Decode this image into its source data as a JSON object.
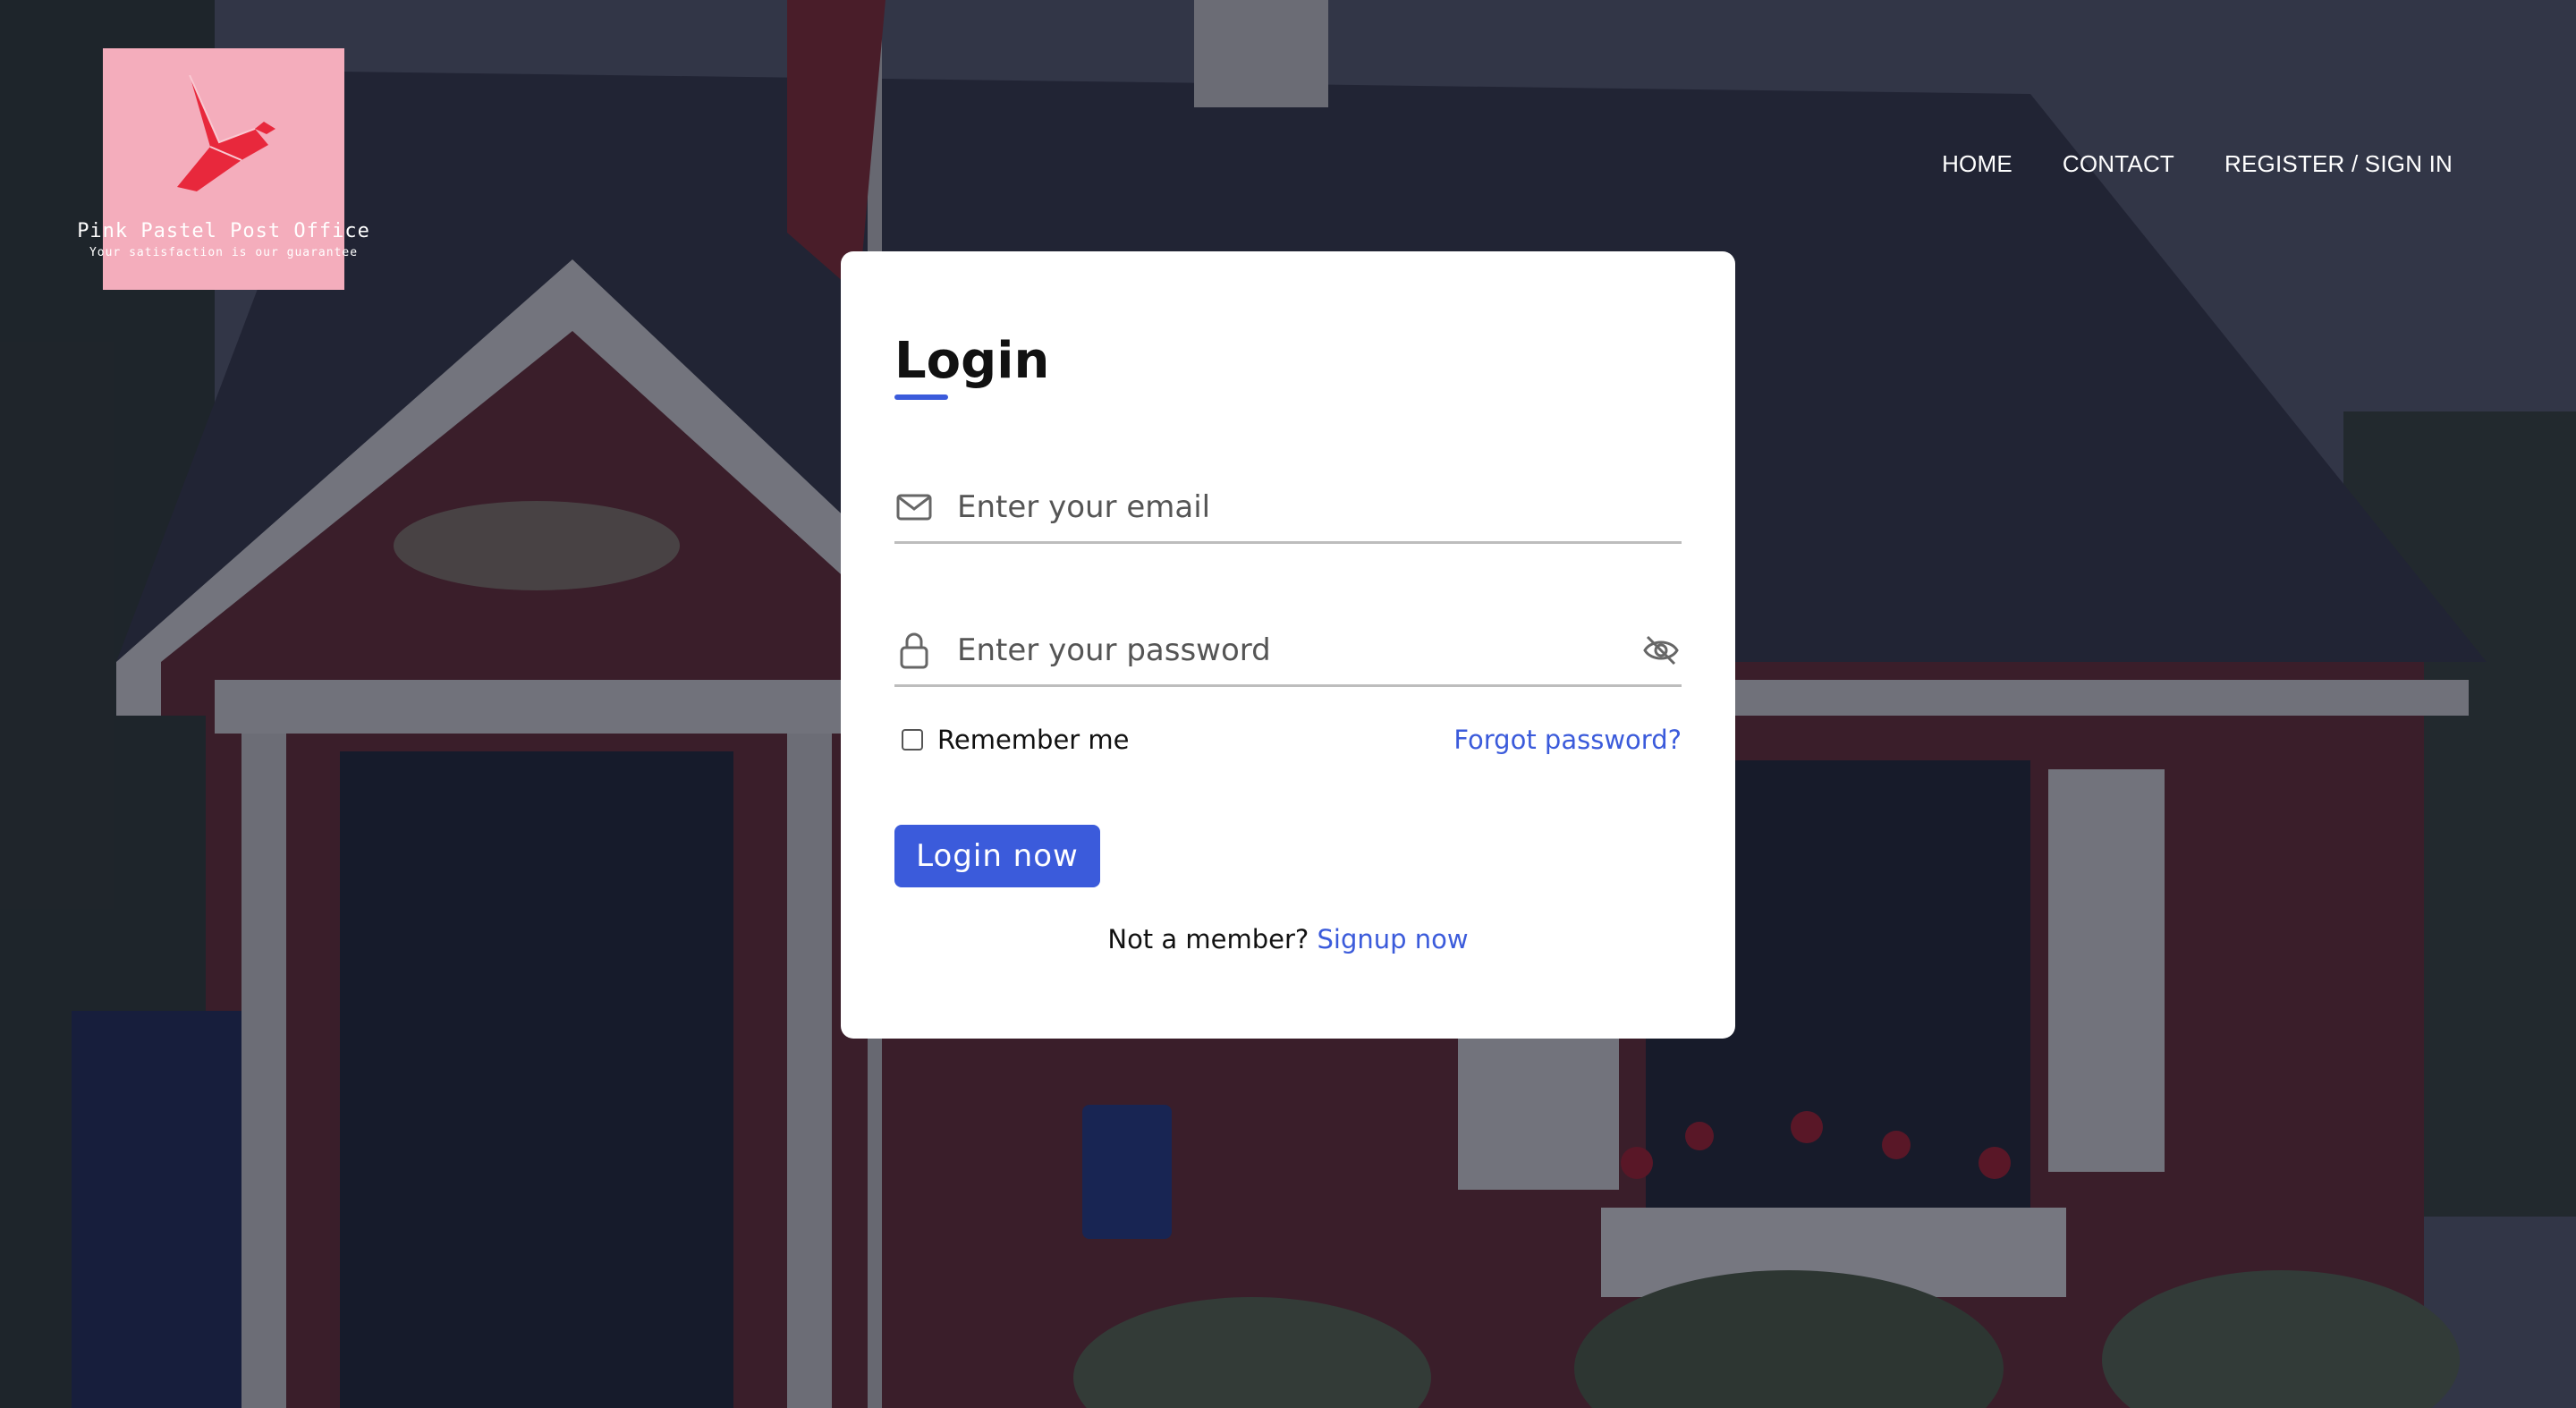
{
  "logo": {
    "title": "Pink Pastel Post Office",
    "tagline": "Your satisfaction is our guarantee",
    "icon": "origami-bird-icon",
    "background_color": "#f4adbc",
    "icon_color": "#e8283c"
  },
  "nav": {
    "items": [
      {
        "label": "HOME"
      },
      {
        "label": "CONTACT"
      },
      {
        "label": "REGISTER / SIGN IN"
      }
    ]
  },
  "login": {
    "title": "Login",
    "email": {
      "placeholder": "Enter your email",
      "icon": "envelope-icon"
    },
    "password": {
      "placeholder": "Enter your password",
      "icon": "lock-icon",
      "toggle_icon": "eye-slash-icon"
    },
    "remember_label": "Remember me",
    "remember_checked": false,
    "forgot_label": "Forgot password?",
    "submit_label": "Login now",
    "signup_prompt": "Not a member?",
    "signup_link": "Signup now"
  },
  "colors": {
    "accent": "#3b5bdb",
    "card": "#ffffff",
    "overlay": "#121424"
  }
}
